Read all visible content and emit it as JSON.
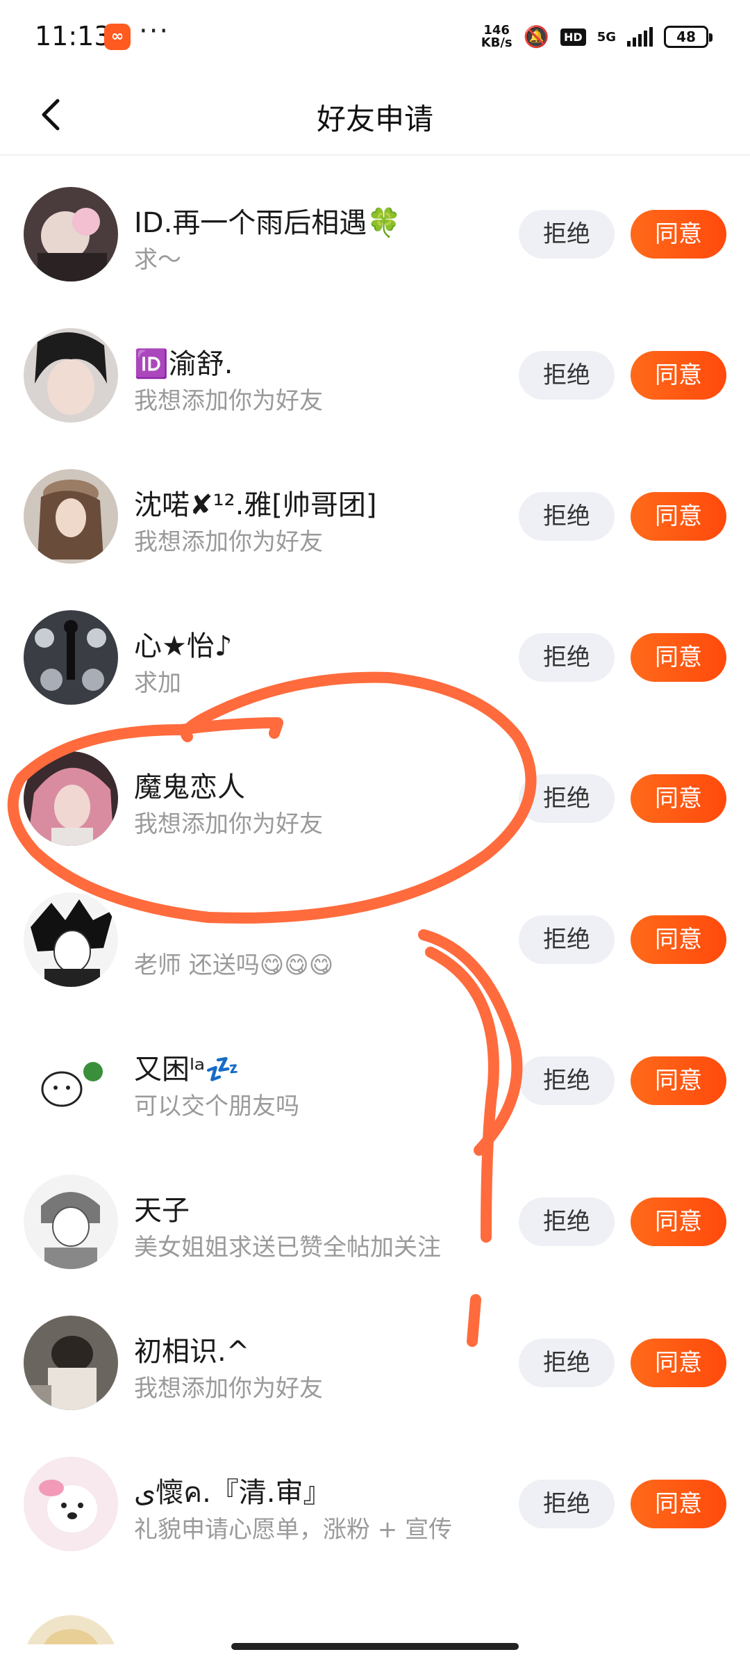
{
  "status_bar": {
    "time": "11:13",
    "more": "···",
    "network_speed_value": "146",
    "network_speed_unit": "KB/s",
    "hd": "HD",
    "signal": "5G",
    "battery": "48"
  },
  "header": {
    "title": "好友申请",
    "back_icon": "chevron-left-icon"
  },
  "requests": [
    {
      "name": "ID.再一个雨后相遇🍀",
      "message": "求～",
      "reject_label": "拒绝",
      "accept_label": "同意"
    },
    {
      "name": "🆔渝舒.",
      "message": "我想添加你为好友",
      "reject_label": "拒绝",
      "accept_label": "同意"
    },
    {
      "name": "沈喏✘¹².雅[帅哥团]",
      "message": "我想添加你为好友",
      "reject_label": "拒绝",
      "accept_label": "同意"
    },
    {
      "name": "心★怡♪",
      "message": "求加",
      "reject_label": "拒绝",
      "accept_label": "同意"
    },
    {
      "name": "魔鬼恋人",
      "message": "我想添加你为好友",
      "reject_label": "拒绝",
      "accept_label": "同意"
    },
    {
      "name": "",
      "message": "老师  还送吗😋😋😋",
      "reject_label": "拒绝",
      "accept_label": "同意"
    },
    {
      "name": "又困ˡᵃ💤",
      "message": "可以交个朋友吗",
      "reject_label": "拒绝",
      "accept_label": "同意"
    },
    {
      "name": "天子",
      "message": "美女姐姐求送已赞全帖加关注",
      "reject_label": "拒绝",
      "accept_label": "同意"
    },
    {
      "name": "初相识.^",
      "message": "我想添加你为好友",
      "reject_label": "拒绝",
      "accept_label": "同意"
    },
    {
      "name": "ی懷ค.『清.审』",
      "message": "礼貌申请心愿单，涨粉 + 宣传",
      "reject_label": "拒绝",
      "accept_label": "同意"
    }
  ],
  "colors": {
    "accent": "#ff5a14",
    "reject_bg": "#eef0f5",
    "annotation": "#ff6b3d"
  }
}
